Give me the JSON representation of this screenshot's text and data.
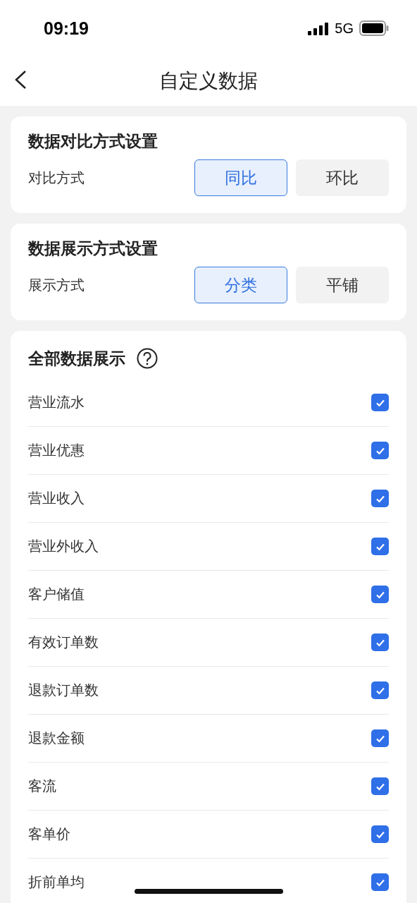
{
  "status_bar": {
    "time": "09:19",
    "network": "5G"
  },
  "header": {
    "title": "自定义数据"
  },
  "settings": [
    {
      "title": "数据对比方式设置",
      "label": "对比方式",
      "options": [
        {
          "label": "同比",
          "selected": true
        },
        {
          "label": "环比",
          "selected": false
        }
      ]
    },
    {
      "title": "数据展示方式设置",
      "label": "展示方式",
      "options": [
        {
          "label": "分类",
          "selected": true
        },
        {
          "label": "平铺",
          "selected": false
        }
      ]
    }
  ],
  "all_data": {
    "title": "全部数据展示",
    "items": [
      {
        "label": "营业流水",
        "checked": true
      },
      {
        "label": "营业优惠",
        "checked": true
      },
      {
        "label": "营业收入",
        "checked": true
      },
      {
        "label": "营业外收入",
        "checked": true
      },
      {
        "label": "客户储值",
        "checked": true
      },
      {
        "label": "有效订单数",
        "checked": true
      },
      {
        "label": "退款订单数",
        "checked": true
      },
      {
        "label": "退款金额",
        "checked": true
      },
      {
        "label": "客流",
        "checked": true
      },
      {
        "label": "客单价",
        "checked": true
      },
      {
        "label": "折前单均",
        "checked": true
      }
    ]
  }
}
